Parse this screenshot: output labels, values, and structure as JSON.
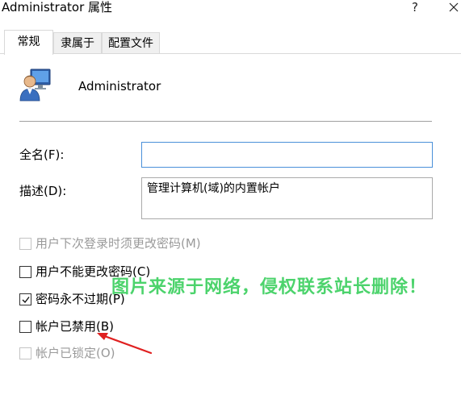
{
  "window": {
    "title": "Administrator 属性",
    "help_glyph": "?"
  },
  "tabs": [
    {
      "label": "常规",
      "active": true
    },
    {
      "label": "隶属于",
      "active": false
    },
    {
      "label": "配置文件",
      "active": false
    }
  ],
  "user": {
    "name": "Administrator",
    "icon": "user-account-icon"
  },
  "fields": {
    "fullname_label": "全名(F):",
    "fullname_value": "",
    "description_label": "描述(D):",
    "description_value": "管理计算机(域)的内置帐户"
  },
  "checkboxes": [
    {
      "label": "用户下次登录时须更改密码(M)",
      "checked": false,
      "disabled": true
    },
    {
      "label": "用户不能更改密码(C)",
      "checked": false,
      "disabled": false
    },
    {
      "label": "密码永不过期(P)",
      "checked": true,
      "disabled": false
    },
    {
      "label": "帐户已禁用(B)",
      "checked": false,
      "disabled": false
    },
    {
      "label": "帐户已锁定(O)",
      "checked": false,
      "disabled": true
    }
  ],
  "overlay": {
    "watermark": "图片来源于网络，侵权联系站长删除！",
    "watermark_color": "#3dd060",
    "arrow_color": "#e02020"
  }
}
